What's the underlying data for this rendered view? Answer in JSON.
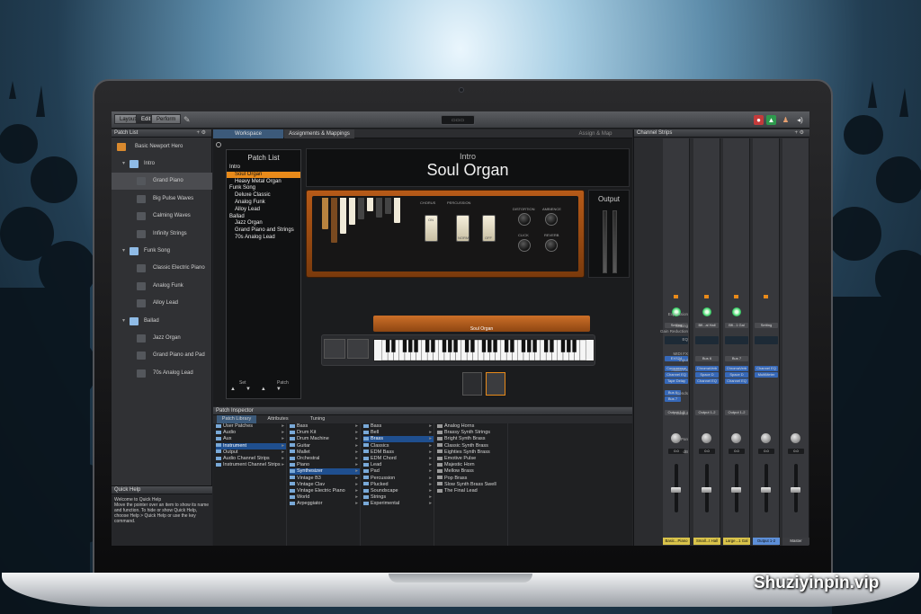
{
  "app": {
    "modes": [
      "Layout",
      "Edit",
      "Perform"
    ],
    "active_mode": "Edit",
    "lcd_text": "▭▭▭"
  },
  "library": {
    "header": "Patch List",
    "root": "Basic Newport Hero",
    "items": [
      {
        "label": "Intro",
        "type": "folder"
      },
      {
        "label": "Grand Piano",
        "type": "patch",
        "selected": true
      },
      {
        "label": "Big Pulse Waves",
        "type": "patch"
      },
      {
        "label": "Calming Waves",
        "type": "patch"
      },
      {
        "label": "Infinity Strings",
        "type": "patch"
      },
      {
        "label": "Funk Song",
        "type": "folder"
      },
      {
        "label": "Classic Electric Piano",
        "type": "patch"
      },
      {
        "label": "Analog Funk",
        "type": "patch"
      },
      {
        "label": "Alloy Lead",
        "type": "patch"
      },
      {
        "label": "Ballad",
        "type": "folder"
      },
      {
        "label": "Jazz Organ",
        "type": "patch"
      },
      {
        "label": "Grand Piano and Pad",
        "type": "patch"
      },
      {
        "label": "70s Analog Lead",
        "type": "patch"
      }
    ]
  },
  "quick_help": {
    "header": "Quick Help",
    "title": "Welcome to Quick Help",
    "body": "Move the pointer over an item to show its name and function. To hide or show Quick Help, choose Help > Quick Help or use the key command."
  },
  "workspace": {
    "tabs": [
      "Workspace",
      "Assignments & Mappings"
    ],
    "assign_button": "Assign & Map",
    "patch_list": {
      "title": "Patch List",
      "items": [
        {
          "label": "Intro",
          "level": 0
        },
        {
          "label": "Soul Organ",
          "level": 1,
          "selected": true
        },
        {
          "label": "Heavy Metal Organ",
          "level": 1
        },
        {
          "label": "Funk Song",
          "level": 0
        },
        {
          "label": "Deluxe Classic",
          "level": 1
        },
        {
          "label": "Analog Funk",
          "level": 1
        },
        {
          "label": "Alloy Lead",
          "level": 1
        },
        {
          "label": "Ballad",
          "level": 0
        },
        {
          "label": "Jazz Organ",
          "level": 1
        },
        {
          "label": "Grand Piano and Strings",
          "level": 1
        },
        {
          "label": "70s Analog Lead",
          "level": 1
        }
      ],
      "set_label": "Set",
      "patch_label": "Patch"
    },
    "set_name": "Intro",
    "patch_name": "Soul Organ",
    "organ": {
      "chorus_label": "CHORUS",
      "percussion_label": "PERCUSSION",
      "distortion_label": "DISTORTION",
      "ambience_label": "AMBIENCE",
      "click_label": "CLICK",
      "reverb_label": "REVERB",
      "rocker_on": "ON",
      "rocker_off": "OFF",
      "rocker_norm": "NORM"
    },
    "output_label": "Output",
    "keyboard_label": "Soul Organ"
  },
  "inspector": {
    "header": "Patch Inspector",
    "tabs": [
      "Patch Library",
      "Attributes",
      "Tuning"
    ],
    "col1": [
      {
        "label": "User Patches"
      },
      {
        "label": "Audio"
      },
      {
        "label": "Aux"
      },
      {
        "label": "Instrument",
        "selected": true
      },
      {
        "label": "Output"
      },
      {
        "label": "Audio Channel Strips"
      },
      {
        "label": "Instrument Channel Strips"
      }
    ],
    "col2": [
      {
        "label": "Bass"
      },
      {
        "label": "Drum Kit"
      },
      {
        "label": "Drum Machine"
      },
      {
        "label": "Guitar"
      },
      {
        "label": "Mallet"
      },
      {
        "label": "Orchestral"
      },
      {
        "label": "Piano"
      },
      {
        "label": "Synthesizer",
        "selected": true
      },
      {
        "label": "Vintage B3"
      },
      {
        "label": "Vintage Clav"
      },
      {
        "label": "Vintage Electric Piano"
      },
      {
        "label": "World"
      },
      {
        "label": "Arpeggiator"
      }
    ],
    "col3": [
      {
        "label": "Bass"
      },
      {
        "label": "Bell"
      },
      {
        "label": "Brass",
        "selected": true
      },
      {
        "label": "Classics"
      },
      {
        "label": "EDM Bass"
      },
      {
        "label": "EDM Chord"
      },
      {
        "label": "Lead"
      },
      {
        "label": "Pad"
      },
      {
        "label": "Percussion"
      },
      {
        "label": "Plucked"
      },
      {
        "label": "Soundscape"
      },
      {
        "label": "Strings"
      },
      {
        "label": "Experimental"
      }
    ],
    "col4": [
      {
        "label": "Analog Horns"
      },
      {
        "label": "Brassy Synth Strings"
      },
      {
        "label": "Bright Synth Brass"
      },
      {
        "label": "Classic Synth Brass"
      },
      {
        "label": "Eighties Synth Brass"
      },
      {
        "label": "Emotive Pulse"
      },
      {
        "label": "Majestic Horn"
      },
      {
        "label": "Mellow Brass"
      },
      {
        "label": "Pop Brass"
      },
      {
        "label": "Slow Synth Brass Swell"
      },
      {
        "label": "The Final Lead"
      }
    ]
  },
  "mixer": {
    "header": "Channel Strips",
    "row_labels": [
      "Expression",
      "Setting",
      "Gain Reduction",
      "EQ",
      "MIDI FX",
      "Input",
      "Audio FX",
      "Sends",
      "Output",
      "Pan",
      "dB"
    ],
    "strips": [
      {
        "name": "Basic...Piano",
        "setting": "Setting",
        "input": "EXS24",
        "fx": [
          "Compressor",
          "Channel EQ",
          "Tape Delay"
        ],
        "sends": [
          "Bus 6",
          "Bus 7"
        ],
        "output": "Output 1-2",
        "db": "0.0",
        "name_color": "#d9c34a"
      },
      {
        "name": "Small...t Hall",
        "setting": "Bfl...al Hall",
        "input": "Bus 6",
        "fx": [
          "ChromaVerb",
          "Space D",
          "Channel EQ"
        ],
        "sends": [],
        "output": "Output 1-2",
        "db": "0.0",
        "name_color": "#d9c34a"
      },
      {
        "name": "Large...1 Gal",
        "setting": "Bfl...1 Gal",
        "input": "Bus 7",
        "fx": [
          "ChromaVerb",
          "Space D",
          "Channel EQ"
        ],
        "sends": [],
        "output": "Output 1-2",
        "db": "0.0",
        "name_color": "#d9c34a"
      },
      {
        "name": "Output 1-2",
        "setting": "Setting",
        "input": "",
        "fx": [
          "Channel EQ",
          "MultiMeter"
        ],
        "sends": [],
        "output": "",
        "db": "0.0",
        "name_color": "#5d8fd8"
      },
      {
        "name": "Master",
        "setting": "",
        "input": "",
        "fx": [],
        "sends": [],
        "output": "",
        "db": "0.0",
        "name_color": "#3a3b3f"
      }
    ]
  },
  "watermark": "Shuziyinpin.vip",
  "colors": {
    "accent": "#e88a1a",
    "selection": "#1f4f8f",
    "wood": "#b65a18"
  }
}
